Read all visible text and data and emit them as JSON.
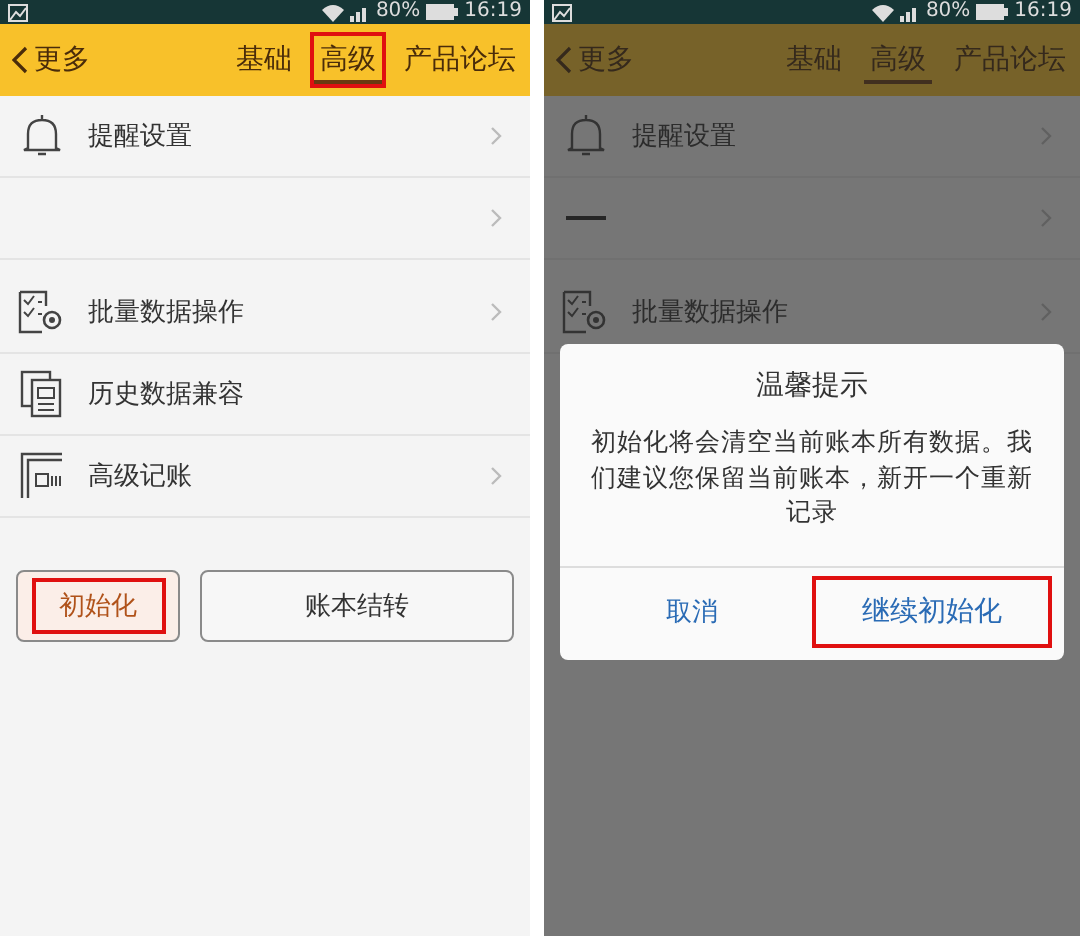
{
  "screens": [
    {
      "status": {
        "battery": "80%",
        "time": "16:19"
      },
      "header": {
        "back": "更多",
        "tabs": [
          {
            "label": "基础",
            "selected": false,
            "highlighted": false
          },
          {
            "label": "高级",
            "selected": true,
            "highlighted": true
          },
          {
            "label": "产品论坛",
            "selected": false,
            "highlighted": false
          }
        ]
      },
      "groups": [
        {
          "items": [
            {
              "kind": "bell",
              "label": "提醒设置",
              "chevron": true
            },
            {
              "kind": "blank",
              "chevron": true
            }
          ]
        },
        {
          "items": [
            {
              "kind": "checklist",
              "label": "批量数据操作",
              "chevron": true
            },
            {
              "kind": "documents",
              "label": "历史数据兼容",
              "chevron": false
            },
            {
              "kind": "layout",
              "label": "高级记账",
              "chevron": true
            }
          ]
        }
      ],
      "buttons": [
        {
          "label": "初始化",
          "kind": "primary",
          "highlighted": true
        },
        {
          "label": "账本结转",
          "kind": "default",
          "highlighted": false
        }
      ]
    },
    {
      "status": {
        "battery": "80%",
        "time": "16:19"
      },
      "header": {
        "back": "更多",
        "tabs": [
          {
            "label": "基础",
            "selected": false,
            "highlighted": false
          },
          {
            "label": "高级",
            "selected": true,
            "highlighted": false
          },
          {
            "label": "产品论坛",
            "selected": false,
            "highlighted": false
          }
        ]
      },
      "groups": [
        {
          "items": [
            {
              "kind": "bell",
              "label": "提醒设置",
              "chevron": true
            },
            {
              "kind": "dash",
              "chevron": true
            }
          ]
        },
        {
          "items": [
            {
              "kind": "checklist",
              "label": "批量数据操作",
              "chevron": true
            }
          ]
        }
      ],
      "dialog": {
        "title": "温馨提示",
        "message": "初始化将会清空当前账本所有数据。我们建议您保留当前账本，新开一个重新记录",
        "buttons": [
          {
            "label": "取消",
            "highlighted": false
          },
          {
            "label": "继续初始化",
            "highlighted": true
          }
        ]
      }
    }
  ]
}
